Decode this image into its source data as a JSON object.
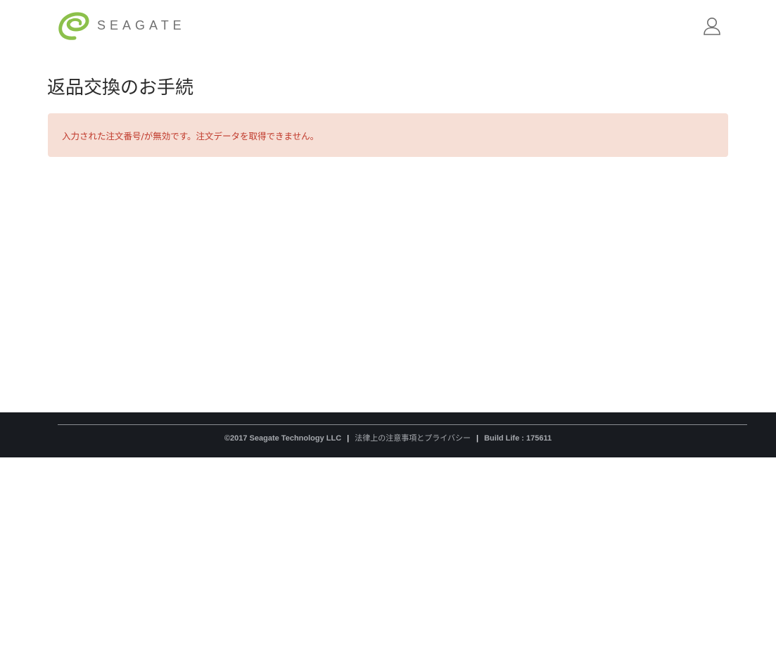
{
  "header": {
    "brand_name": "SEAGATE",
    "brand_color": "#8cc04b",
    "user_icon": "user-icon"
  },
  "main": {
    "page_title": "返品交換のお手続",
    "alert": {
      "message": "入力された注文番号/が無効です。注文データを取得できません。",
      "background": "#f6dfd6",
      "text_color": "#c0392b"
    }
  },
  "footer": {
    "copyright": "©2017 Seagate Technology LLC",
    "separator": "|",
    "legal_link": "法律上の注意事項とプライバシー",
    "build_info": "Build Life : 175611",
    "background": "#181b20"
  }
}
